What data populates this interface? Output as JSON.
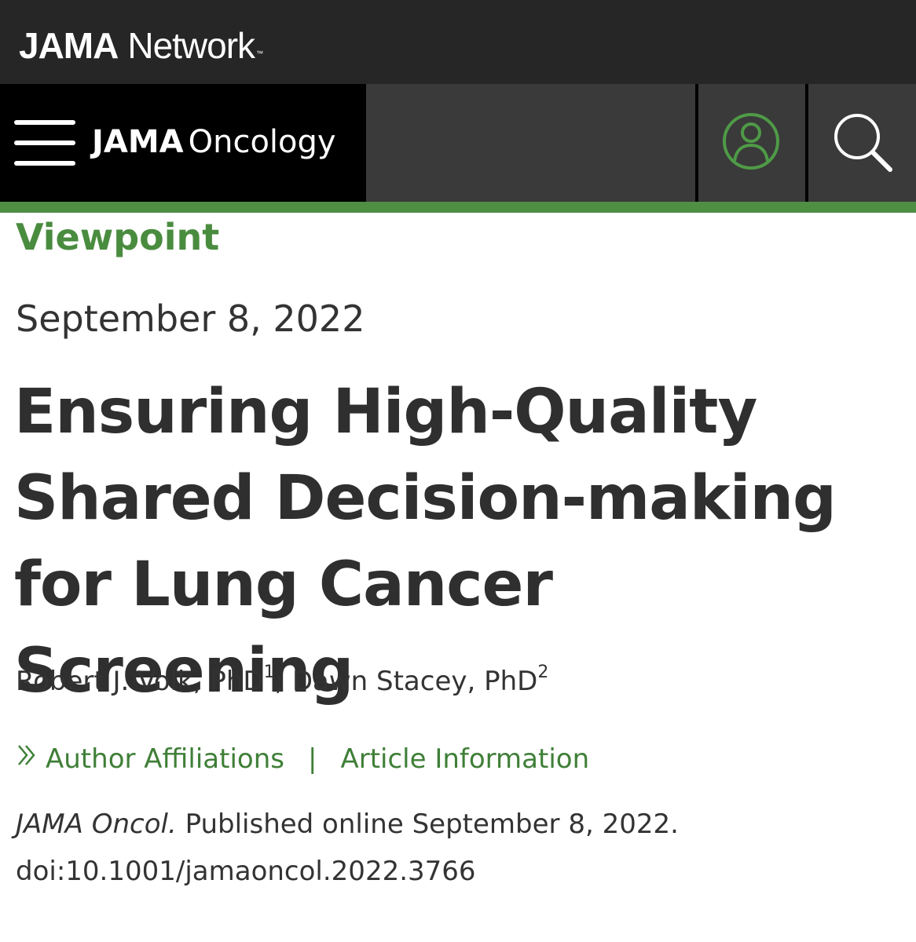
{
  "network_bar": {
    "logo_bold": "JAMA",
    "logo_regular": "Network",
    "logo_trademark": "™"
  },
  "nav": {
    "journal_bold": "JAMA",
    "journal_regular": "Oncology",
    "menu_icon": "hamburger-menu-icon",
    "user_icon": "user-account-icon",
    "search_icon": "search-icon"
  },
  "article": {
    "type": "Viewpoint",
    "date": "September 8, 2022",
    "title": "Ensuring High-Quality Shared Decision-making for Lung Cancer Screening",
    "authors": [
      {
        "name": "Robert J. Volk, PhD",
        "affiliation": "1"
      },
      {
        "name": "Dawn Stacey, PhD",
        "affiliation": "2"
      }
    ],
    "author_separator": ";",
    "links": {
      "author_affiliations": "Author Affiliations",
      "separator": "|",
      "article_information": "Article Information"
    },
    "citation": {
      "journal_abbrev": "JAMA Oncol.",
      "published_text": "Published online September 8, 2022.",
      "doi": "doi:10.1001/jamaoncol.2022.3766"
    }
  },
  "colors": {
    "network_bar_bg": "#262626",
    "nav_bg": "#3a3a3a",
    "brand_bg": "#000000",
    "accent_green": "#4a8c3f",
    "title_text": "#2f2f2f"
  }
}
